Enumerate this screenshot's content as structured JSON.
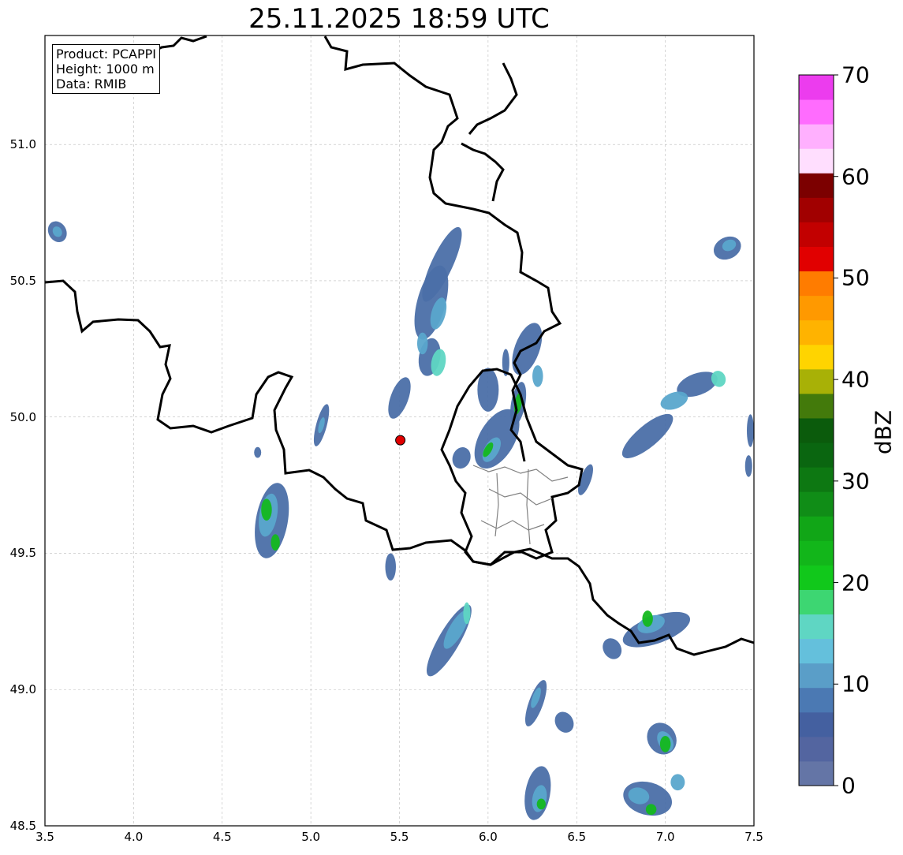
{
  "title": "25.11.2025 18:59 UTC",
  "info_box": {
    "product": "Product: PCAPPI",
    "height": "Height: 1000 m",
    "data": "Data: RMIB"
  },
  "axes": {
    "x_ticks": [
      "3.5",
      "4.0",
      "4.5",
      "5.0",
      "5.5",
      "6.0",
      "6.5",
      "7.0",
      "7.5"
    ],
    "y_ticks": [
      "48.5",
      "49.0",
      "49.5",
      "50.0",
      "50.5",
      "51.0"
    ],
    "x_range": [
      3.5,
      7.5
    ],
    "y_range": [
      48.5,
      51.4
    ],
    "grid": "dashed"
  },
  "radar_site": {
    "lon": 5.505,
    "lat": 49.915,
    "color": "#e00000"
  },
  "colorbar": {
    "label": "dBZ",
    "ticks": [
      "0",
      "10",
      "20",
      "30",
      "40",
      "50",
      "60",
      "70"
    ],
    "range": [
      0,
      70
    ],
    "step": 2.5,
    "colors": [
      "#6475a6",
      "#5365a0",
      "#4460a0",
      "#4b79b3",
      "#5a9ec8",
      "#64c0dc",
      "#5fd6c3",
      "#3dd672",
      "#11c81b",
      "#12b61a",
      "#11a617",
      "#108d17",
      "#0d7812",
      "#0a6610",
      "#0b5b0c",
      "#437a0b",
      "#a8b106",
      "#ffd400",
      "#ffb300",
      "#ff9900",
      "#ff7c00",
      "#e10000",
      "#c20000",
      "#a10000",
      "#7c0000",
      "#ffdefe",
      "#ffb0fe",
      "#ff6cfe",
      "#ec3cee"
    ]
  },
  "echo_colors": {
    "weak": "#4b6fa8",
    "light": "#5aa6cc",
    "moderate": "#5fd6c3",
    "strong": "#14b81e"
  }
}
